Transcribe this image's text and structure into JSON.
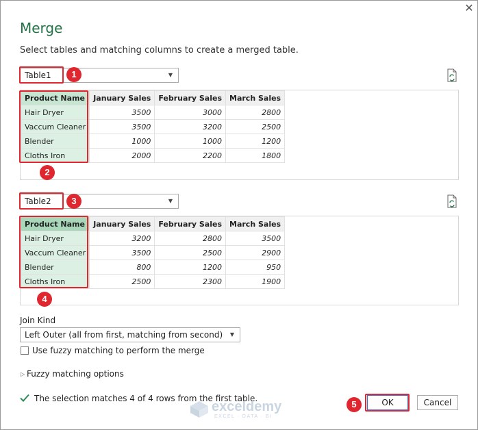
{
  "dialog": {
    "title": "Merge",
    "subtitle": "Select tables and matching columns to create a merged table.",
    "close_icon": "close-icon"
  },
  "table1": {
    "selected": "Table1",
    "headers": [
      "Product Name",
      "January Sales",
      "February Sales",
      "March Sales"
    ],
    "rows": [
      [
        "Hair Dryer",
        "3500",
        "3000",
        "2800"
      ],
      [
        "Vaccum Cleaner",
        "3500",
        "3200",
        "2500"
      ],
      [
        "Blender",
        "1000",
        "1000",
        "1200"
      ],
      [
        "Cloths Iron",
        "2000",
        "2200",
        "1800"
      ]
    ]
  },
  "table2": {
    "selected": "Table2",
    "headers": [
      "Product Name",
      "January Sales",
      "February Sales",
      "March Sales"
    ],
    "rows": [
      [
        "Hair Dryer",
        "3200",
        "2800",
        "3500"
      ],
      [
        "Vaccum Cleaner",
        "3500",
        "2500",
        "2900"
      ],
      [
        "Blender",
        "800",
        "1200",
        "950"
      ],
      [
        "Cloths Iron",
        "2500",
        "2300",
        "1900"
      ]
    ]
  },
  "join": {
    "label": "Join Kind",
    "selected": "Left Outer (all from first, matching from second)",
    "fuzzy_checkbox_label": "Use fuzzy matching to perform the merge",
    "fuzzy_checked": false,
    "fuzzy_options_label": "Fuzzy matching options"
  },
  "status": {
    "message": "The selection matches 4 of 4 rows from the first table."
  },
  "buttons": {
    "ok": "OK",
    "cancel": "Cancel"
  },
  "annotations": {
    "badges": [
      "1",
      "2",
      "3",
      "4",
      "5"
    ],
    "color": "#e0262e"
  },
  "watermark": {
    "name": "exceldemy",
    "tagline": "EXCEL · DATA · BI"
  },
  "colors": {
    "title": "#217346",
    "selected_column": "#dcf0e3",
    "check": "#2e8b57"
  }
}
